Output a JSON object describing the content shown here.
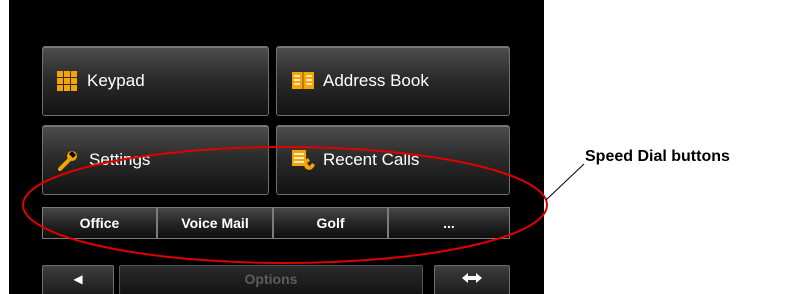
{
  "buttons": {
    "keypad": "Keypad",
    "address_book": "Address Book",
    "settings": "Settings",
    "recent_calls": "Recent Calls"
  },
  "speed_dial": [
    "Office",
    "Voice Mail",
    "Golf",
    "..."
  ],
  "bottom_bar": {
    "options": "Options",
    "left_arrow": "◀",
    "swap_arrows": "◆"
  },
  "annotation": {
    "callout": "Speed Dial buttons",
    "ellipse_color": "#e00000"
  },
  "colors": {
    "icon_orange": "#f7a500",
    "screen_bg": "#000000"
  },
  "icons": [
    "keypad-icon",
    "address-book-icon",
    "wrench-icon",
    "recent-calls-icon",
    "left-arrow-icon",
    "swap-arrows-icon"
  ]
}
